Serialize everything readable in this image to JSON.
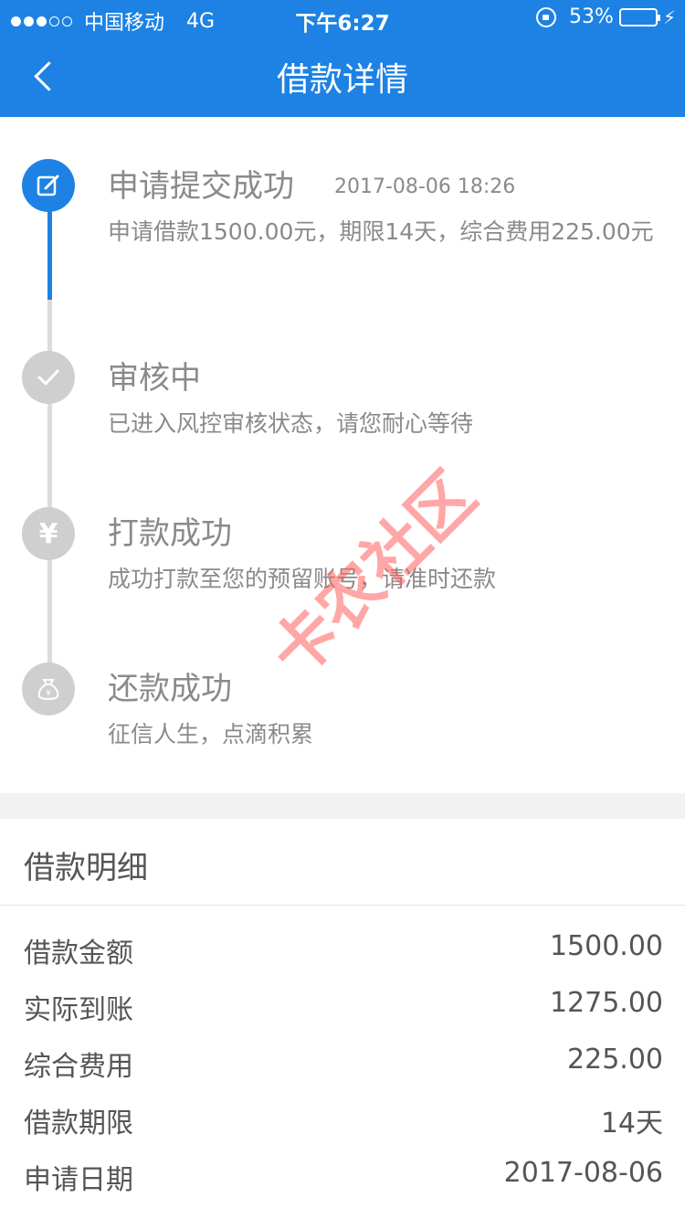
{
  "status_bar": {
    "signal": "●●●○○",
    "carrier": "中国移动",
    "network": "4G",
    "time": "下午6:27",
    "battery_percent": "53%",
    "battery_level": 0.53,
    "icons": [
      "orientation-lock-icon",
      "battery-icon",
      "charging-bolt-icon"
    ]
  },
  "nav": {
    "title": "借款详情",
    "back_icon": "chevron-left-icon"
  },
  "colors": {
    "primary": "#1d82e3",
    "inactive": "#cfcfcf",
    "text_gray": "#8a8a8a",
    "battery_green": "#4cd964",
    "watermark": "#ff6060"
  },
  "timeline": [
    {
      "title": "申请提交成功",
      "time": "2017-08-06 18:26",
      "desc": "申请借款1500.00元，期限14天，综合费用225.00元",
      "icon": "edit-icon",
      "active": true
    },
    {
      "title": "审核中",
      "desc": "已进入风控审核状态，请您耐心等待",
      "icon": "check-icon",
      "active": false
    },
    {
      "title": "打款成功",
      "desc": "成功打款至您的预留账号，请准时还款",
      "icon": "yen-icon",
      "icon_glyph": "¥",
      "active": false
    },
    {
      "title": "还款成功",
      "desc": "征信人生，点滴积累",
      "icon": "money-bag-icon",
      "active": false
    }
  ],
  "watermark": "卡农社区",
  "detail": {
    "header": "借款明细",
    "rows": [
      {
        "label": "借款金额",
        "value": "1500.00"
      },
      {
        "label": "实际到账",
        "value": "1275.00"
      },
      {
        "label": "综合费用",
        "value": "225.00"
      },
      {
        "label": "借款期限",
        "value": "14天"
      },
      {
        "label": "申请日期",
        "value": "2017-08-06"
      }
    ]
  }
}
